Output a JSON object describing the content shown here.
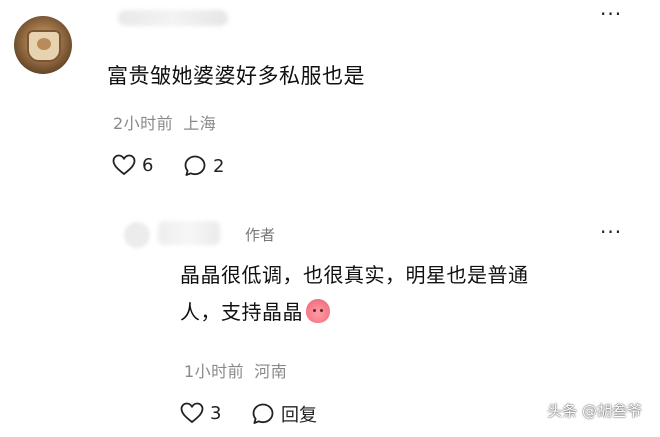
{
  "comment": {
    "text": "富贵皱她婆婆好多私服也是",
    "time": "2小时前",
    "location": "上海",
    "likes": "6",
    "replies": "2",
    "more_label": "···"
  },
  "reply": {
    "badge": "作者",
    "text_line1": "晶晶很低调，也很真实，明星也是普通",
    "text_line2": "人，支持晶晶",
    "time": "1小时前",
    "location": "河南",
    "likes": "3",
    "reply_label": "回复",
    "more_label": "···"
  },
  "watermark": "头条 @胡叁爷",
  "icons": {
    "like": "heart-outline-icon",
    "comment": "speech-bubble-icon",
    "more": "more-dots-icon",
    "emoji": "peach-emoji-icon"
  },
  "colors": {
    "text": "#111111",
    "meta": "#8a8a8a"
  }
}
